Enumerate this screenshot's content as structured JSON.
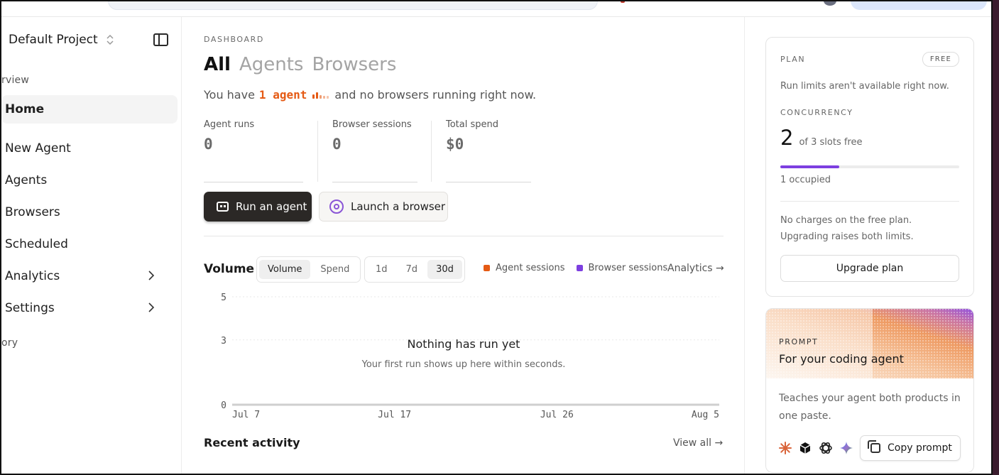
{
  "project": {
    "name": "Default Project"
  },
  "sidebar": {
    "section_overview": "rview",
    "section_history": "ory",
    "items": [
      {
        "label": "Home",
        "active": true
      },
      {
        "label": "New Agent"
      },
      {
        "label": "Agents"
      },
      {
        "label": "Browsers"
      },
      {
        "label": "Scheduled"
      },
      {
        "label": "Analytics",
        "has_submenu": true
      },
      {
        "label": "Settings",
        "has_submenu": true
      }
    ]
  },
  "dashboard": {
    "eyebrow": "DASHBOARD",
    "tabs": [
      "All",
      "Agents",
      "Browsers"
    ],
    "active_tab": "All",
    "running_prefix": "You have",
    "running_highlight": "1 agent",
    "running_suffix": "and no browsers running right now.",
    "stats": [
      {
        "label": "Agent runs",
        "value": "0"
      },
      {
        "label": "Browser sessions",
        "value": "0"
      },
      {
        "label": "Total spend",
        "value": "$0"
      }
    ],
    "run_agent_label": "Run an agent",
    "launch_browser_label": "Launch a browser"
  },
  "volume": {
    "title": "Volume",
    "metric_options": [
      "Volume",
      "Spend"
    ],
    "metric_selected": "Volume",
    "range_options": [
      "1d",
      "7d",
      "30d"
    ],
    "range_selected": "30d",
    "legend": [
      {
        "name": "Agent sessions",
        "color": "#e55a14"
      },
      {
        "name": "Browser sessions",
        "color": "#7d3fe0"
      }
    ],
    "analytics_link": "Analytics →",
    "empty_title": "Nothing has run yet",
    "empty_sub": "Your first run shows up here within seconds."
  },
  "chart_data": {
    "type": "area",
    "x_ticks": [
      "Jul 7",
      "Jul 17",
      "Jul 26",
      "Aug 5"
    ],
    "y_ticks": [
      0,
      3,
      5
    ],
    "ylim": [
      0,
      5
    ],
    "series": [
      {
        "name": "Agent sessions",
        "values": []
      },
      {
        "name": "Browser sessions",
        "values": []
      }
    ],
    "grid": true
  },
  "recent": {
    "title": "Recent activity",
    "view_all": "View all →"
  },
  "plan": {
    "caption": "PLAN",
    "badge": "FREE",
    "limits_text": "Run limits aren't available right now.",
    "concurrency_caption": "CONCURRENCY",
    "slots_free": "2",
    "slots_text": "of 3 slots free",
    "occupied_fraction": 0.33,
    "occupied_text": "1 occupied",
    "note_line1": "No charges on the free plan.",
    "note_line2": "Upgrading raises both limits.",
    "upgrade_label": "Upgrade plan"
  },
  "prompt": {
    "caption": "PROMPT",
    "title": "For your coding agent",
    "desc_line1": "Teaches your agent both products in",
    "desc_line2": "one paste.",
    "copy_label": "Copy prompt",
    "logos": [
      "claude-icon",
      "cube-icon",
      "openai-icon",
      "gemini-icon"
    ]
  }
}
